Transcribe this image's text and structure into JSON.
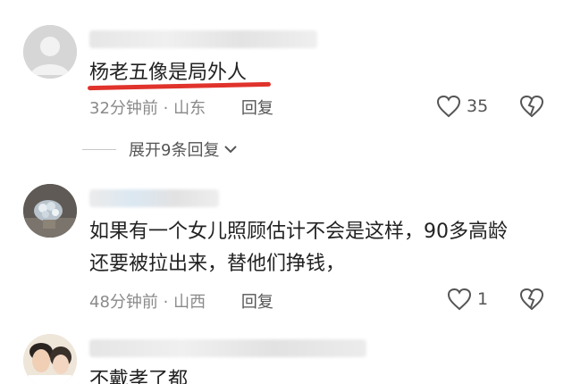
{
  "comments": [
    {
      "text": "杨老五像是局外人",
      "time": "32分钟前",
      "location": "山东",
      "reply_label": "回复",
      "likes": "35",
      "expand_label": "展开9条回复"
    },
    {
      "text_line1": "如果有一个女儿照顾估计不会是这样，90多高龄",
      "text_line2": "还要被拉出来，替他们挣钱，",
      "time": "48分钟前",
      "location": "山西",
      "reply_label": "回复",
      "likes": "1"
    },
    {
      "text": "不戴孝了都"
    }
  ],
  "meta_separator": "·",
  "colors": {
    "highlight_underline": "#e0332c",
    "meta_text": "#8a8a8a"
  }
}
